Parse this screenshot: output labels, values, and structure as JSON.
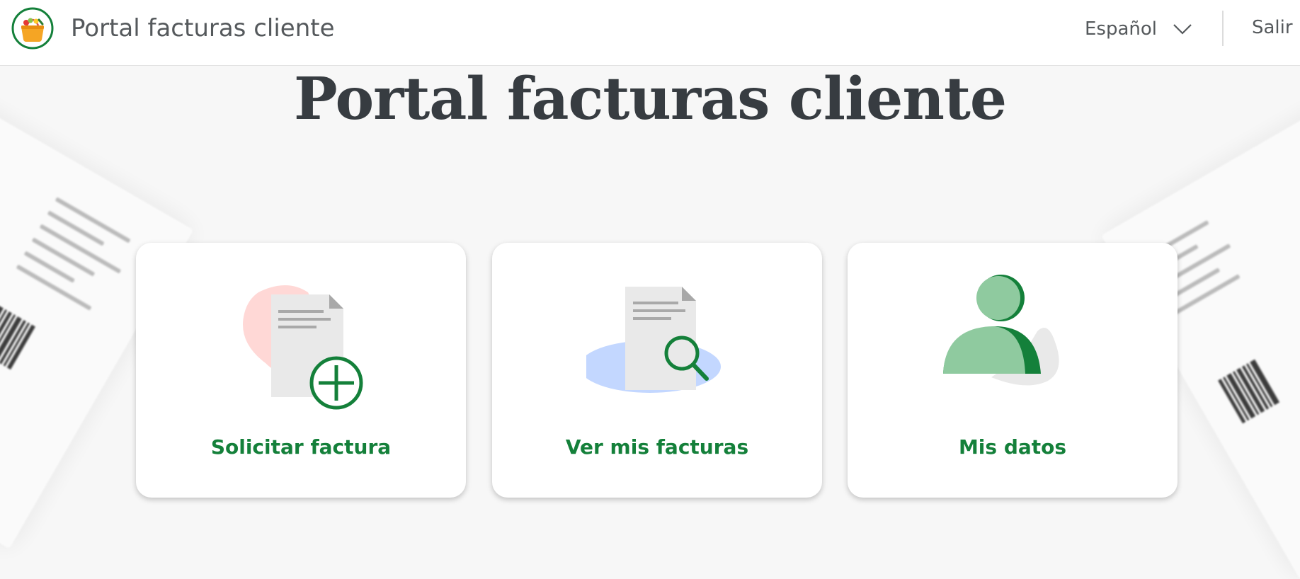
{
  "header": {
    "app_title": "Portal facturas cliente",
    "language": "Español",
    "logout_label": "Salir",
    "logo_icon": "shopping-basket-logo"
  },
  "main": {
    "title": "Portal facturas cliente"
  },
  "cards": [
    {
      "label": "Solicitar factura",
      "icon": "add-invoice-icon"
    },
    {
      "label": "Ver mis facturas",
      "icon": "search-invoice-icon"
    },
    {
      "label": "Mis datos",
      "icon": "user-profile-icon"
    }
  ],
  "colors": {
    "brand_green": "#14803a",
    "light_green": "#8fca9f",
    "title_dark": "#373c41",
    "pink_blob": "#ffd8d6",
    "blue_blob": "#c3d7ff"
  }
}
